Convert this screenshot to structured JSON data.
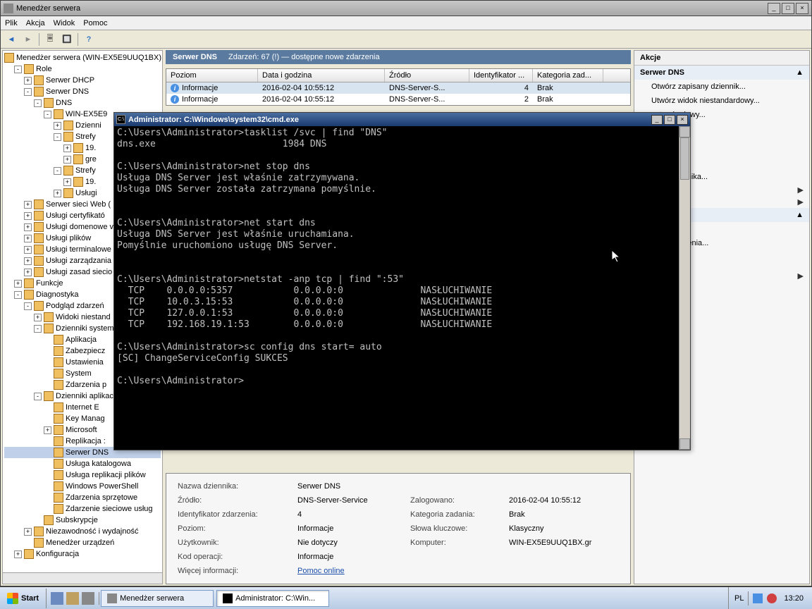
{
  "main": {
    "title": "Menedżer serwera",
    "menu": [
      "Plik",
      "Akcja",
      "Widok",
      "Pomoc"
    ]
  },
  "tree": {
    "root": "Menedżer serwera (WIN-EX5E9UUQ1BX)",
    "items": [
      {
        "pad": 14,
        "exp": "-",
        "label": "Role"
      },
      {
        "pad": 28,
        "exp": "+",
        "label": "Serwer DHCP"
      },
      {
        "pad": 28,
        "exp": "-",
        "label": "Serwer DNS"
      },
      {
        "pad": 42,
        "exp": "-",
        "label": "DNS"
      },
      {
        "pad": 56,
        "exp": "-",
        "label": "WIN-EX5E9"
      },
      {
        "pad": 70,
        "exp": "+",
        "label": "Dzienni"
      },
      {
        "pad": 70,
        "exp": "-",
        "label": "Strefy"
      },
      {
        "pad": 84,
        "exp": "+",
        "label": "19."
      },
      {
        "pad": 84,
        "exp": "+",
        "label": "gre"
      },
      {
        "pad": 70,
        "exp": "-",
        "label": "Strefy"
      },
      {
        "pad": 84,
        "exp": "+",
        "label": "19."
      },
      {
        "pad": 70,
        "exp": "+",
        "label": "Usługi"
      },
      {
        "pad": 28,
        "exp": "+",
        "label": "Serwer sieci Web ("
      },
      {
        "pad": 28,
        "exp": "+",
        "label": "Usługi certyfikató"
      },
      {
        "pad": 28,
        "exp": "+",
        "label": "Usługi domenowe v"
      },
      {
        "pad": 28,
        "exp": "+",
        "label": "Usługi plików"
      },
      {
        "pad": 28,
        "exp": "+",
        "label": "Usługi terminalowe"
      },
      {
        "pad": 28,
        "exp": "+",
        "label": "Usługi zarządzania"
      },
      {
        "pad": 28,
        "exp": "+",
        "label": "Usługi zasad siecio"
      },
      {
        "pad": 14,
        "exp": "+",
        "label": "Funkcje"
      },
      {
        "pad": 14,
        "exp": "-",
        "label": "Diagnostyka"
      },
      {
        "pad": 28,
        "exp": "-",
        "label": "Podgląd zdarzeń"
      },
      {
        "pad": 42,
        "exp": "+",
        "label": "Widoki niestand"
      },
      {
        "pad": 42,
        "exp": "-",
        "label": "Dzienniki system"
      },
      {
        "pad": 56,
        "exp": "",
        "label": "Aplikacja"
      },
      {
        "pad": 56,
        "exp": "",
        "label": "Zabezpiecz"
      },
      {
        "pad": 56,
        "exp": "",
        "label": "Ustawienia"
      },
      {
        "pad": 56,
        "exp": "",
        "label": "System"
      },
      {
        "pad": 56,
        "exp": "",
        "label": "Zdarzenia p"
      },
      {
        "pad": 42,
        "exp": "-",
        "label": "Dzienniki aplikac"
      },
      {
        "pad": 56,
        "exp": "",
        "label": "Internet E"
      },
      {
        "pad": 56,
        "exp": "",
        "label": "Key Manag"
      },
      {
        "pad": 56,
        "exp": "+",
        "label": "Microsoft"
      },
      {
        "pad": 56,
        "exp": "",
        "label": "Replikacja :"
      },
      {
        "pad": 56,
        "exp": "",
        "label": "Serwer DNS",
        "sel": true
      },
      {
        "pad": 56,
        "exp": "",
        "label": "Usługa katalogowa"
      },
      {
        "pad": 56,
        "exp": "",
        "label": "Usługa replikacji plików"
      },
      {
        "pad": 56,
        "exp": "",
        "label": "Windows PowerShell"
      },
      {
        "pad": 56,
        "exp": "",
        "label": "Zdarzenia sprzętowe"
      },
      {
        "pad": 56,
        "exp": "",
        "label": "Zdarzenie sieciowe usług"
      },
      {
        "pad": 42,
        "exp": "",
        "label": "Subskrypcje"
      },
      {
        "pad": 28,
        "exp": "+",
        "label": "Niezawodność i wydajność"
      },
      {
        "pad": 28,
        "exp": "",
        "label": "Menedżer urządzeń"
      },
      {
        "pad": 14,
        "exp": "+",
        "label": "Konfiguracja"
      }
    ]
  },
  "mid": {
    "headerTitle": "Serwer DNS",
    "headerInfo": "Zdarzeń: 67 (!) — dostępne nowe zdarzenia",
    "columns": {
      "level": "Poziom",
      "date": "Data i godzina",
      "source": "Źródło",
      "id": "Identyfikator ...",
      "cat": "Kategoria zad..."
    },
    "rows": [
      {
        "level": "Informacje",
        "date": "2016-02-04 10:55:12",
        "source": "DNS-Server-S...",
        "id": "4",
        "cat": "Brak",
        "sel": true
      },
      {
        "level": "Informacje",
        "date": "2016-02-04 10:55:12",
        "source": "DNS-Server-S...",
        "id": "2",
        "cat": "Brak"
      }
    ]
  },
  "detail": {
    "labels": {
      "nazwa": "Nazwa dziennika:",
      "zrodlo": "Źródło:",
      "id": "Identyfikator zdarzenia:",
      "poziom": "Poziom:",
      "uzytk": "Użytkownik:",
      "kod": "Kod operacji:",
      "wiecej": "Więcej informacji:",
      "zalog": "Zalogowano:",
      "kat": "Kategoria zadania:",
      "slowa": "Słowa kluczowe:",
      "komputer": "Komputer:"
    },
    "values": {
      "nazwa": "Serwer DNS",
      "zrodlo": "DNS-Server-Service",
      "id": "4",
      "poziom": "Informacje",
      "uzytk": "Nie dotyczy",
      "kod": "Informacje",
      "wiecej": "Pomoc online",
      "zalog": "2016-02-04 10:55:12",
      "kat": "Brak",
      "slowa": "Klasyczny",
      "komputer": "WIN-EX5E9UUQ1BX.gr"
    }
  },
  "actions": {
    "title": "Akcje",
    "group1": "Serwer DNS",
    "items1": [
      "Otwórz zapisany dziennik...",
      "Utwórz widok niestandardowy...",
      "estandardowy...",
      "...",
      "ennik...",
      "",
      "ako...",
      "tego dziennika..."
    ],
    "group2": "erver-Service",
    "items2": [
      "enia",
      "tego zdarzenia...",
      "",
      "darzenia..."
    ]
  },
  "cmd": {
    "title": "Administrator: C:\\Windows\\system32\\cmd.exe",
    "body": "C:\\Users\\Administrator>tasklist /svc | find \"DNS\"\ndns.exe                       1984 DNS\n\nC:\\Users\\Administrator>net stop dns\nUsługa DNS Server jest właśnie zatrzymywana.\nUsługa DNS Server została zatrzymana pomyślnie.\n\n\nC:\\Users\\Administrator>net start dns\nUsługa DNS Server jest właśnie uruchamiana.\nPomyślnie uruchomiono usługę DNS Server.\n\n\nC:\\Users\\Administrator>netstat -anp tcp | find \":53\"\n  TCP    0.0.0.0:5357           0.0.0.0:0              NASŁUCHIWANIE\n  TCP    10.0.3.15:53           0.0.0.0:0              NASŁUCHIWANIE\n  TCP    127.0.0.1:53           0.0.0.0:0              NASŁUCHIWANIE\n  TCP    192.168.19.1:53        0.0.0.0:0              NASŁUCHIWANIE\n\nC:\\Users\\Administrator>sc config dns start= auto\n[SC] ChangeServiceConfig SUKCES\n\nC:\\Users\\Administrator>"
  },
  "taskbar": {
    "start": "Start",
    "task1": "Menedżer serwera",
    "task2": "Administrator: C:\\Win...",
    "lang": "PL",
    "clock": "13:20"
  }
}
